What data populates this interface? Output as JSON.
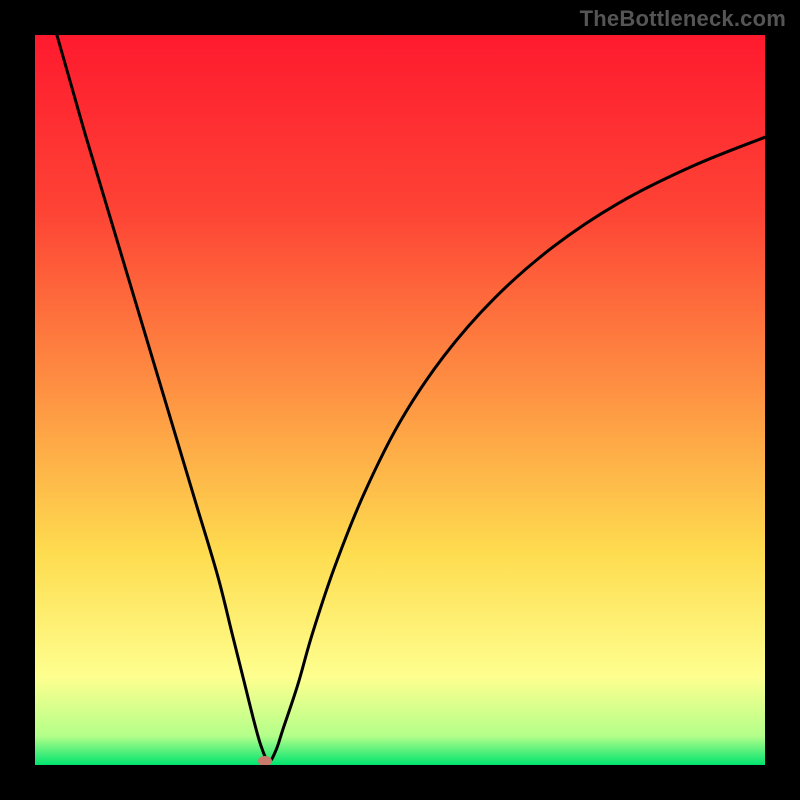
{
  "watermark": "TheBottleneck.com",
  "chart_data": {
    "type": "line",
    "title": "",
    "xlabel": "",
    "ylabel": "",
    "xlim": [
      0,
      100
    ],
    "ylim": [
      0,
      100
    ],
    "series": [
      {
        "name": "bottleneck-curve",
        "x": [
          3,
          5,
          7,
          10,
          13,
          16,
          19,
          22,
          25,
          27,
          28.5,
          30,
          31,
          32,
          33,
          34,
          36,
          38,
          41,
          45,
          50,
          56,
          63,
          71,
          80,
          90,
          100
        ],
        "values": [
          100,
          93,
          86,
          76,
          66,
          56,
          46,
          36,
          26,
          18,
          12,
          6,
          2.5,
          0.5,
          2,
          5,
          11,
          18,
          27,
          37,
          47,
          56,
          64,
          71,
          77,
          82,
          86
        ]
      }
    ],
    "marker": {
      "x": 31.5,
      "y": 0.6,
      "color": "#c97a6d"
    },
    "gradient_stops": {
      "top": "#fe1a2e",
      "red_mid": "#fe4335",
      "orange": "#fe8f42",
      "yellow": "#fedc4f",
      "pale_yellow": "#feff8f",
      "pale_green": "#b4ff8a",
      "green": "#00e46f",
      "pos_red_mid": 24,
      "pos_orange": 48,
      "pos_yellow": 71,
      "pos_pale_yellow": 88,
      "pos_pale_green": 96,
      "pos_green": 100
    },
    "stroke": "#000000",
    "stroke_width": 3
  }
}
